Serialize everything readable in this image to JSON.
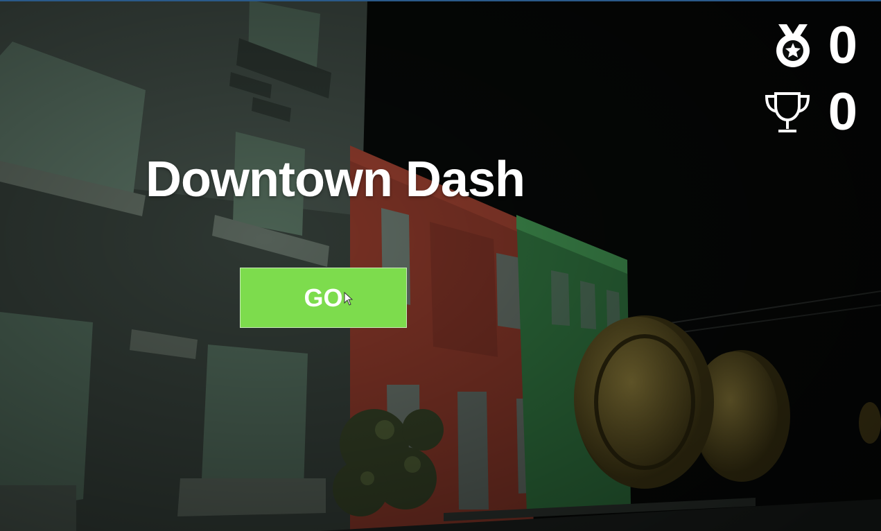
{
  "game": {
    "title": "Downtown Dash",
    "go_label": "GO"
  },
  "hud": {
    "medal_icon": "medal-icon",
    "medal_value": "0",
    "trophy_icon": "trophy-icon",
    "trophy_value": "0"
  },
  "colors": {
    "go_button": "#7ddc4d",
    "text": "#ffffff"
  }
}
